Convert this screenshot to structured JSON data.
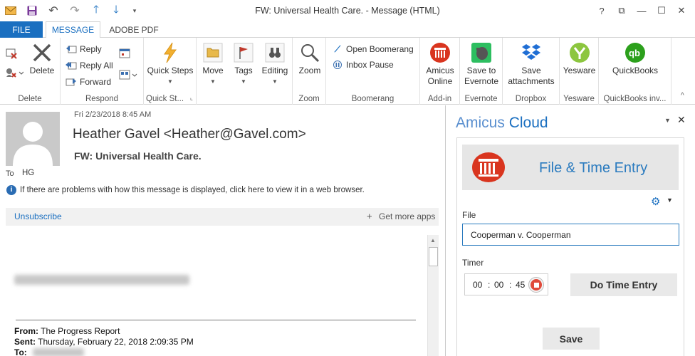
{
  "window": {
    "title": "FW: Universal Health Care.  - Message (HTML)",
    "help": "?",
    "restore": "⧉",
    "minimize": "—",
    "maximize": "☐",
    "close": "✕"
  },
  "tabs": [
    "FILE",
    "MESSAGE",
    "ADOBE PDF"
  ],
  "ribbon": {
    "delete_group": {
      "label": "Delete",
      "delete": "Delete"
    },
    "respond_group": {
      "label": "Respond",
      "reply": "Reply",
      "reply_all": "Reply All",
      "forward": "Forward"
    },
    "quicksteps_group": {
      "label": "Quick St...",
      "quick_steps": "Quick Steps"
    },
    "move_group": {
      "move": "Move",
      "tags": "Tags",
      "editing": "Editing"
    },
    "zoom_group": {
      "label": "Zoom",
      "zoom": "Zoom"
    },
    "boomerang_group": {
      "label": "Boomerang",
      "open": "Open Boomerang",
      "pause": "Inbox Pause"
    },
    "addin_group": {
      "label": "Add-in",
      "amicus_line1": "Amicus",
      "amicus_line2": "Online"
    },
    "evernote_group": {
      "label": "Evernote",
      "line1": "Save to",
      "line2": "Evernote"
    },
    "dropbox_group": {
      "label": "Dropbox",
      "line1": "Save",
      "line2": "attachments"
    },
    "yesware_group": {
      "label": "Yesware",
      "line1": "Yesware"
    },
    "quickbooks_group": {
      "label": "QuickBooks inv...",
      "line1": "QuickBooks"
    }
  },
  "message": {
    "date": "Fri 2/23/2018 8:45 AM",
    "sender": "Heather Gavel <Heather@Gavel.com>",
    "subject": "FW: Universal Health Care.",
    "to_label": "To",
    "to_value": "HG",
    "info_text": "If there are problems with how this message is displayed, click here to view it in a web browser.",
    "unsubscribe": "Unsubscribe",
    "get_more_apps": "Get more apps",
    "from_label": "From:",
    "from_value": "The Progress Report",
    "sent_label": "Sent:",
    "sent_value": "Thursday, February 22, 2018 2:09:35 PM",
    "to2_label": "To:"
  },
  "amicus": {
    "brand_a": "Amicus",
    "brand_b": "Cloud",
    "header_title": "File & Time Entry",
    "file_label": "File",
    "file_value": "Cooperman v. Cooperman",
    "timer_label": "Timer",
    "timer_h": "00",
    "timer_m": "00",
    "timer_s": "45",
    "timer_sep": ":",
    "do_time_entry": "Do Time Entry",
    "save": "Save",
    "brand_color": "#1a6fc0",
    "logo_color": "#d9351f"
  }
}
